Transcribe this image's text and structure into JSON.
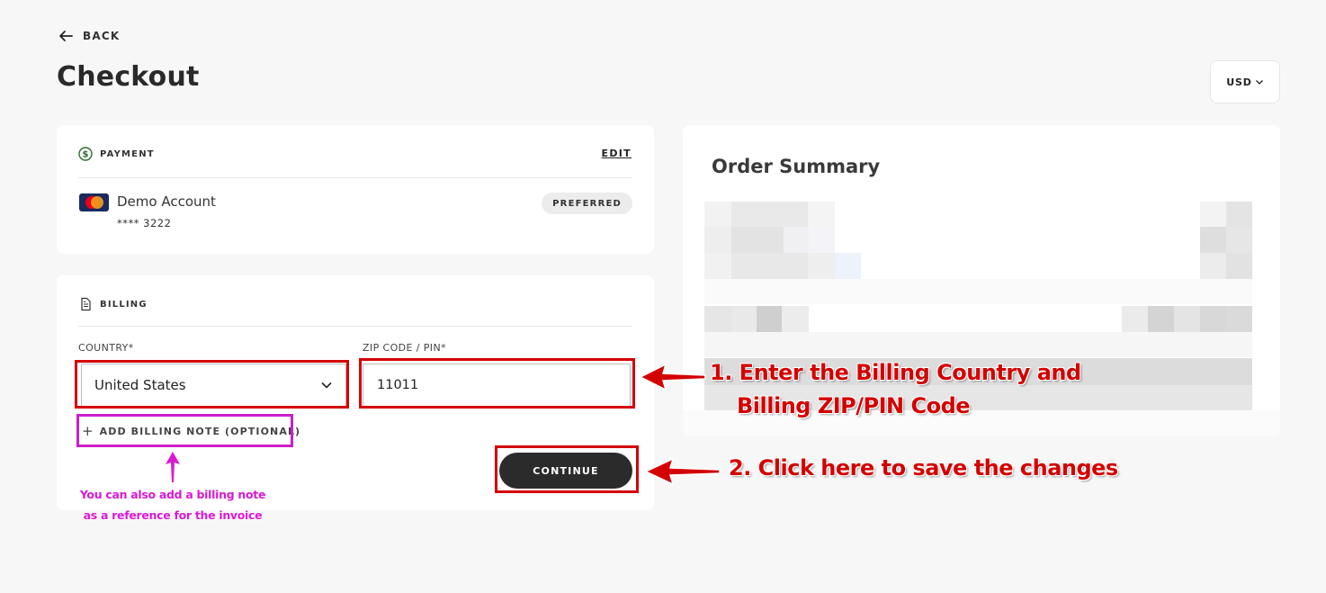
{
  "nav": {
    "back_label": "BACK"
  },
  "page": {
    "title": "Checkout"
  },
  "currency": {
    "value": "USD"
  },
  "payment": {
    "section_label": "PAYMENT",
    "edit_label": "EDIT",
    "account_name": "Demo Account",
    "account_number": "**** 3222",
    "badge": "PREFERRED"
  },
  "billing": {
    "section_label": "BILLING",
    "country_label": "COUNTRY*",
    "country_value": "United States",
    "zip_label": "ZIP CODE / PIN*",
    "zip_value": "11011",
    "add_note_label": "ADD BILLING NOTE (OPTIONAL)",
    "continue_label": "CONTINUE"
  },
  "summary": {
    "title": "Order Summary"
  },
  "annotations": {
    "step1_line1": "1. Enter the Billing Country and",
    "step1_line2": "Billing ZIP/PIN Code",
    "step2": "2. Click here to save the changes",
    "note_line1": "You can also add a billing note",
    "note_line2": "as a reference for the invoice"
  },
  "colors": {
    "annotation_red": "#d40000",
    "annotation_pink": "#cc1ec8",
    "button_dark": "#2b2b2b"
  }
}
